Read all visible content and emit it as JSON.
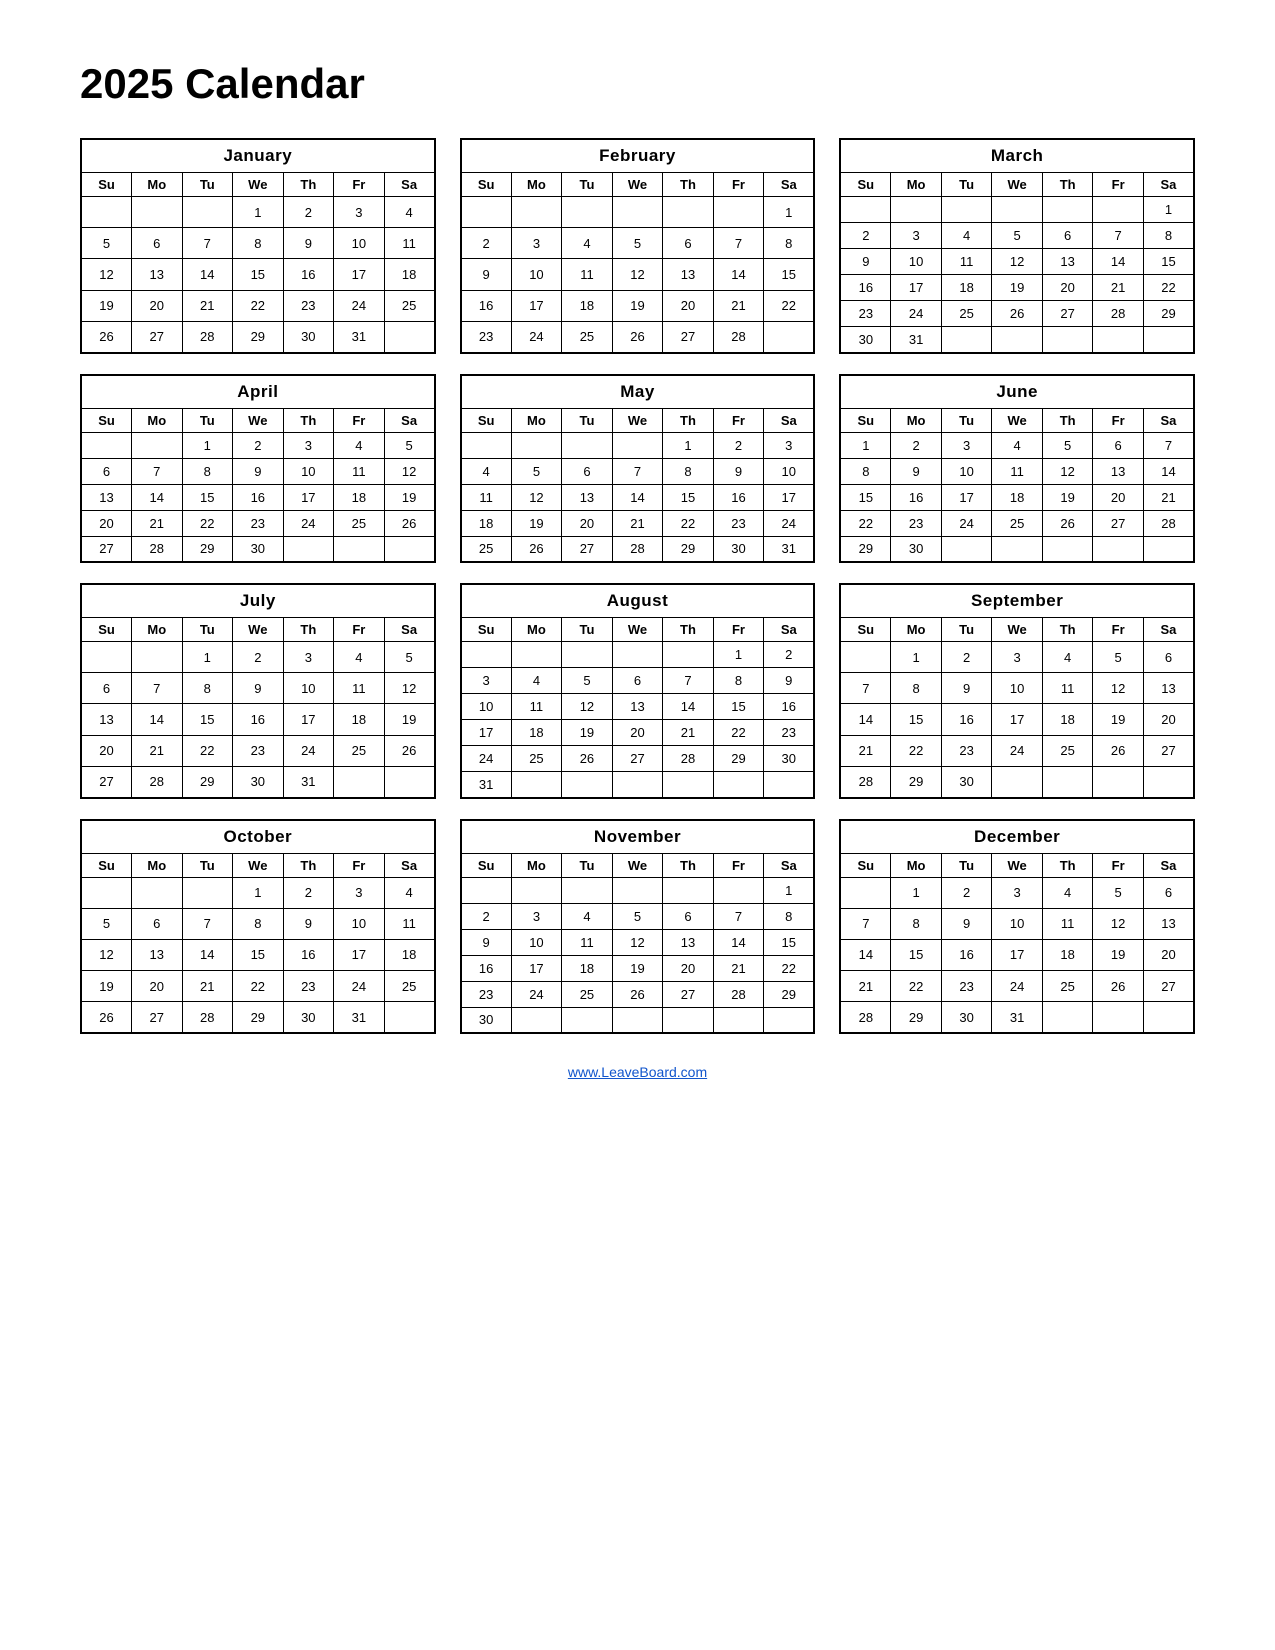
{
  "title": "2025 Calendar",
  "footer_link": "www.LeaveBoard.com",
  "days_header": [
    "Su",
    "Mo",
    "Tu",
    "We",
    "Th",
    "Fr",
    "Sa"
  ],
  "months": [
    {
      "name": "January",
      "weeks": [
        [
          "",
          "",
          "",
          "1",
          "2",
          "3",
          "4"
        ],
        [
          "5",
          "6",
          "7",
          "8",
          "9",
          "10",
          "11"
        ],
        [
          "12",
          "13",
          "14",
          "15",
          "16",
          "17",
          "18"
        ],
        [
          "19",
          "20",
          "21",
          "22",
          "23",
          "24",
          "25"
        ],
        [
          "26",
          "27",
          "28",
          "29",
          "30",
          "31",
          ""
        ]
      ]
    },
    {
      "name": "February",
      "weeks": [
        [
          "",
          "",
          "",
          "",
          "",
          "",
          "1"
        ],
        [
          "2",
          "3",
          "4",
          "5",
          "6",
          "7",
          "8"
        ],
        [
          "9",
          "10",
          "11",
          "12",
          "13",
          "14",
          "15"
        ],
        [
          "16",
          "17",
          "18",
          "19",
          "20",
          "21",
          "22"
        ],
        [
          "23",
          "24",
          "25",
          "26",
          "27",
          "28",
          ""
        ]
      ]
    },
    {
      "name": "March",
      "weeks": [
        [
          "",
          "",
          "",
          "",
          "",
          "",
          "1"
        ],
        [
          "2",
          "3",
          "4",
          "5",
          "6",
          "7",
          "8"
        ],
        [
          "9",
          "10",
          "11",
          "12",
          "13",
          "14",
          "15"
        ],
        [
          "16",
          "17",
          "18",
          "19",
          "20",
          "21",
          "22"
        ],
        [
          "23",
          "24",
          "25",
          "26",
          "27",
          "28",
          "29"
        ],
        [
          "30",
          "31",
          "",
          "",
          "",
          "",
          ""
        ]
      ]
    },
    {
      "name": "April",
      "weeks": [
        [
          "",
          "",
          "1",
          "2",
          "3",
          "4",
          "5"
        ],
        [
          "6",
          "7",
          "8",
          "9",
          "10",
          "11",
          "12"
        ],
        [
          "13",
          "14",
          "15",
          "16",
          "17",
          "18",
          "19"
        ],
        [
          "20",
          "21",
          "22",
          "23",
          "24",
          "25",
          "26"
        ],
        [
          "27",
          "28",
          "29",
          "30",
          "",
          "",
          ""
        ]
      ]
    },
    {
      "name": "May",
      "weeks": [
        [
          "",
          "",
          "",
          "",
          "1",
          "2",
          "3"
        ],
        [
          "4",
          "5",
          "6",
          "7",
          "8",
          "9",
          "10"
        ],
        [
          "11",
          "12",
          "13",
          "14",
          "15",
          "16",
          "17"
        ],
        [
          "18",
          "19",
          "20",
          "21",
          "22",
          "23",
          "24"
        ],
        [
          "25",
          "26",
          "27",
          "28",
          "29",
          "30",
          "31"
        ]
      ]
    },
    {
      "name": "June",
      "weeks": [
        [
          "1",
          "2",
          "3",
          "4",
          "5",
          "6",
          "7"
        ],
        [
          "8",
          "9",
          "10",
          "11",
          "12",
          "13",
          "14"
        ],
        [
          "15",
          "16",
          "17",
          "18",
          "19",
          "20",
          "21"
        ],
        [
          "22",
          "23",
          "24",
          "25",
          "26",
          "27",
          "28"
        ],
        [
          "29",
          "30",
          "",
          "",
          "",
          "",
          ""
        ]
      ]
    },
    {
      "name": "July",
      "weeks": [
        [
          "",
          "",
          "1",
          "2",
          "3",
          "4",
          "5"
        ],
        [
          "6",
          "7",
          "8",
          "9",
          "10",
          "11",
          "12"
        ],
        [
          "13",
          "14",
          "15",
          "16",
          "17",
          "18",
          "19"
        ],
        [
          "20",
          "21",
          "22",
          "23",
          "24",
          "25",
          "26"
        ],
        [
          "27",
          "28",
          "29",
          "30",
          "31",
          "",
          ""
        ]
      ]
    },
    {
      "name": "August",
      "weeks": [
        [
          "",
          "",
          "",
          "",
          "",
          "1",
          "2"
        ],
        [
          "3",
          "4",
          "5",
          "6",
          "7",
          "8",
          "9"
        ],
        [
          "10",
          "11",
          "12",
          "13",
          "14",
          "15",
          "16"
        ],
        [
          "17",
          "18",
          "19",
          "20",
          "21",
          "22",
          "23"
        ],
        [
          "24",
          "25",
          "26",
          "27",
          "28",
          "29",
          "30"
        ],
        [
          "31",
          "",
          "",
          "",
          "",
          "",
          ""
        ]
      ]
    },
    {
      "name": "September",
      "weeks": [
        [
          "",
          "1",
          "2",
          "3",
          "4",
          "5",
          "6"
        ],
        [
          "7",
          "8",
          "9",
          "10",
          "11",
          "12",
          "13"
        ],
        [
          "14",
          "15",
          "16",
          "17",
          "18",
          "19",
          "20"
        ],
        [
          "21",
          "22",
          "23",
          "24",
          "25",
          "26",
          "27"
        ],
        [
          "28",
          "29",
          "30",
          "",
          "",
          "",
          ""
        ]
      ]
    },
    {
      "name": "October",
      "weeks": [
        [
          "",
          "",
          "",
          "1",
          "2",
          "3",
          "4"
        ],
        [
          "5",
          "6",
          "7",
          "8",
          "9",
          "10",
          "11"
        ],
        [
          "12",
          "13",
          "14",
          "15",
          "16",
          "17",
          "18"
        ],
        [
          "19",
          "20",
          "21",
          "22",
          "23",
          "24",
          "25"
        ],
        [
          "26",
          "27",
          "28",
          "29",
          "30",
          "31",
          ""
        ]
      ]
    },
    {
      "name": "November",
      "weeks": [
        [
          "",
          "",
          "",
          "",
          "",
          "",
          "1"
        ],
        [
          "2",
          "3",
          "4",
          "5",
          "6",
          "7",
          "8"
        ],
        [
          "9",
          "10",
          "11",
          "12",
          "13",
          "14",
          "15"
        ],
        [
          "16",
          "17",
          "18",
          "19",
          "20",
          "21",
          "22"
        ],
        [
          "23",
          "24",
          "25",
          "26",
          "27",
          "28",
          "29"
        ],
        [
          "30",
          "",
          "",
          "",
          "",
          "",
          ""
        ]
      ]
    },
    {
      "name": "December",
      "weeks": [
        [
          "",
          "1",
          "2",
          "3",
          "4",
          "5",
          "6"
        ],
        [
          "7",
          "8",
          "9",
          "10",
          "11",
          "12",
          "13"
        ],
        [
          "14",
          "15",
          "16",
          "17",
          "18",
          "19",
          "20"
        ],
        [
          "21",
          "22",
          "23",
          "24",
          "25",
          "26",
          "27"
        ],
        [
          "28",
          "29",
          "30",
          "31",
          "",
          "",
          ""
        ]
      ]
    }
  ]
}
